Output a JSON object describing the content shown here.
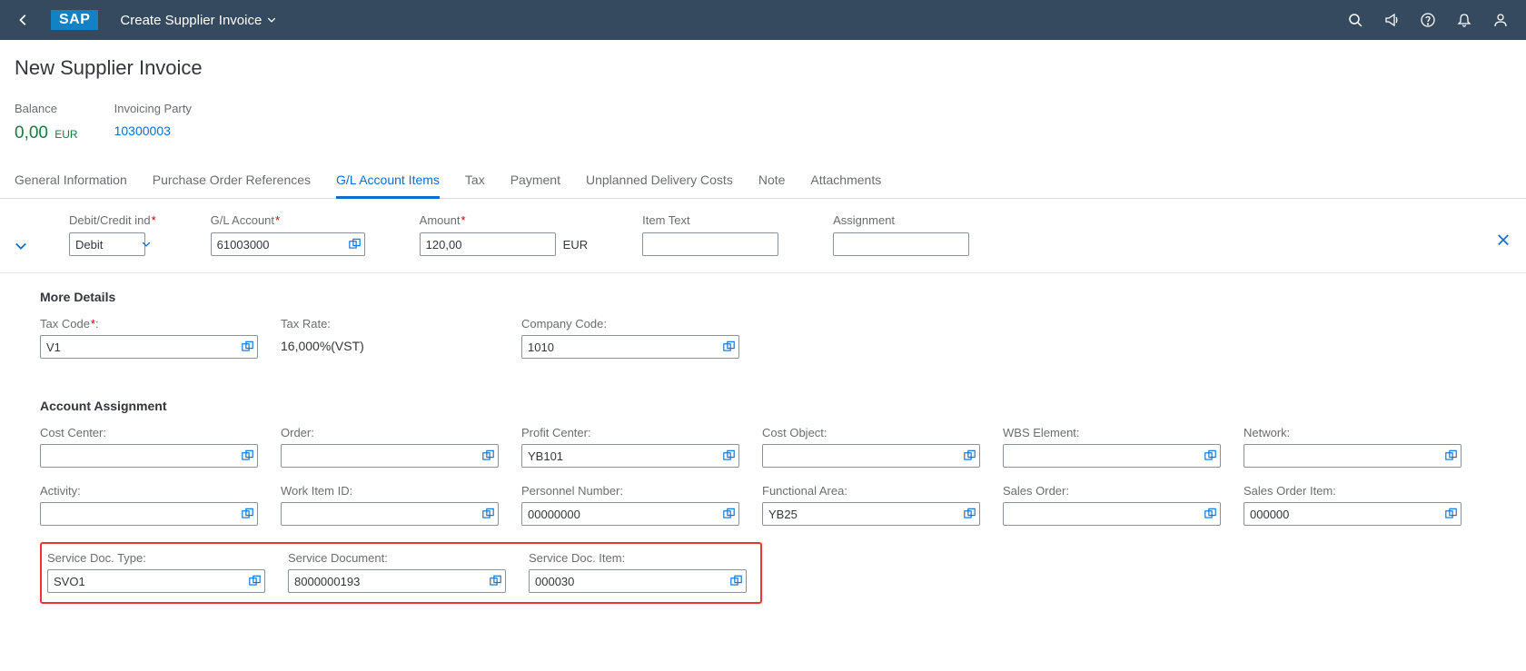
{
  "shell": {
    "app_title": "Create Supplier Invoice"
  },
  "header": {
    "page_title": "New Supplier Invoice",
    "balance_label": "Balance",
    "balance_value": "0,00",
    "balance_currency": "EUR",
    "party_label": "Invoicing Party",
    "party_value": "10300003"
  },
  "tabs": [
    "General Information",
    "Purchase Order References",
    "G/L Account Items",
    "Tax",
    "Payment",
    "Unplanned Delivery Costs",
    "Note",
    "Attachments"
  ],
  "active_tab_index": 2,
  "line": {
    "dc_label": "Debit/Credit ind",
    "dc_value": "Debit",
    "gl_label": "G/L Account",
    "gl_value": "61003000",
    "amount_label": "Amount",
    "amount_value": "120,00",
    "amount_currency": "EUR",
    "itemtext_label": "Item Text",
    "itemtext_value": "",
    "assignment_label": "Assignment",
    "assignment_value": ""
  },
  "more_details": {
    "title": "More Details",
    "taxcode_label": "Tax Code",
    "taxcode_value": "V1",
    "taxrate_label": "Tax Rate:",
    "taxrate_value": "16,000%(VST)",
    "company_label": "Company Code:",
    "company_value": "1010"
  },
  "acct": {
    "title": "Account Assignment",
    "cost_center_label": "Cost Center:",
    "cost_center_value": "",
    "order_label": "Order:",
    "order_value": "",
    "profit_center_label": "Profit Center:",
    "profit_center_value": "YB101",
    "cost_object_label": "Cost Object:",
    "cost_object_value": "",
    "wbs_label": "WBS Element:",
    "wbs_value": "",
    "network_label": "Network:",
    "network_value": "",
    "activity_label": "Activity:",
    "activity_value": "",
    "workitem_label": "Work Item ID:",
    "workitem_value": "",
    "personnel_label": "Personnel Number:",
    "personnel_value": "00000000",
    "funcarea_label": "Functional Area:",
    "funcarea_value": "YB25",
    "salesorder_label": "Sales Order:",
    "salesorder_value": "",
    "salesorderitem_label": "Sales Order Item:",
    "salesorderitem_value": "000000",
    "svc_type_label": "Service Doc. Type:",
    "svc_type_value": "SVO1",
    "svc_doc_label": "Service Document:",
    "svc_doc_value": "8000000193",
    "svc_item_label": "Service Doc. Item:",
    "svc_item_value": "000030"
  }
}
